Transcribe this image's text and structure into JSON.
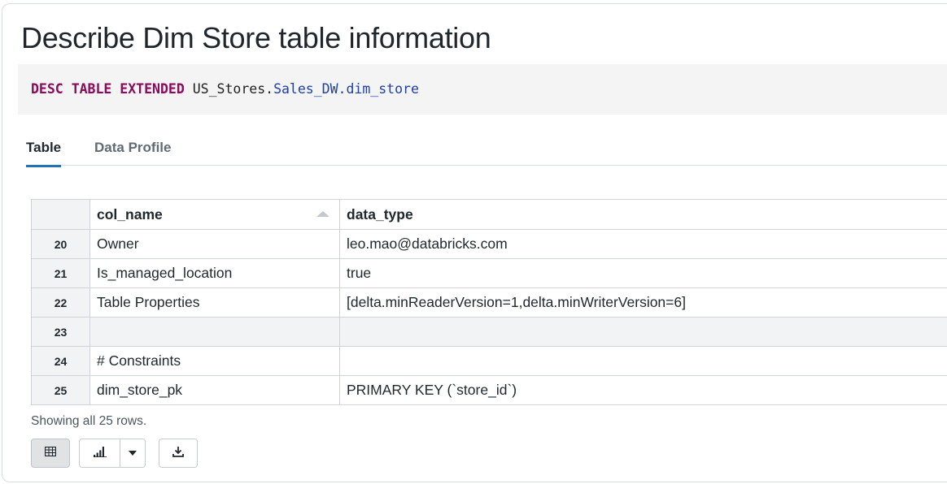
{
  "cell": {
    "title": "Describe Dim Store table information"
  },
  "query": {
    "keyword1": "DESC",
    "keyword2": "TABLE",
    "keyword3": "EXTENDED",
    "catalog": "US_Stores",
    "dot": ".",
    "schema_table": "Sales_DW.dim_store"
  },
  "tabs": [
    {
      "label": "Table",
      "active": true
    },
    {
      "label": "Data Profile",
      "active": false
    }
  ],
  "table": {
    "columns": [
      "col_name",
      "data_type"
    ],
    "sort_icon": "sort-ascending-icon",
    "rows": [
      {
        "idx": "20",
        "col_name": "Owner",
        "data_type": "leo.mao@databricks.com"
      },
      {
        "idx": "21",
        "col_name": "Is_managed_location",
        "data_type": "true"
      },
      {
        "idx": "22",
        "col_name": "Table Properties",
        "data_type": "[delta.minReaderVersion=1,delta.minWriterVersion=6]"
      },
      {
        "idx": "23",
        "col_name": "",
        "data_type": ""
      },
      {
        "idx": "24",
        "col_name": "# Constraints",
        "data_type": ""
      },
      {
        "idx": "25",
        "col_name": "dim_store_pk",
        "data_type": "PRIMARY KEY (`store_id`)"
      }
    ]
  },
  "footer": {
    "row_count_text": "Showing all 25 rows.",
    "icons": [
      "table-view-icon",
      "bar-chart-icon",
      "chevron-down-icon",
      "download-icon"
    ]
  },
  "colors": {
    "keyword": "#8b0a5c",
    "identifier": "#1c3fa8",
    "active_tab": "#2272b4",
    "code_bg": "#f4f4f5"
  }
}
